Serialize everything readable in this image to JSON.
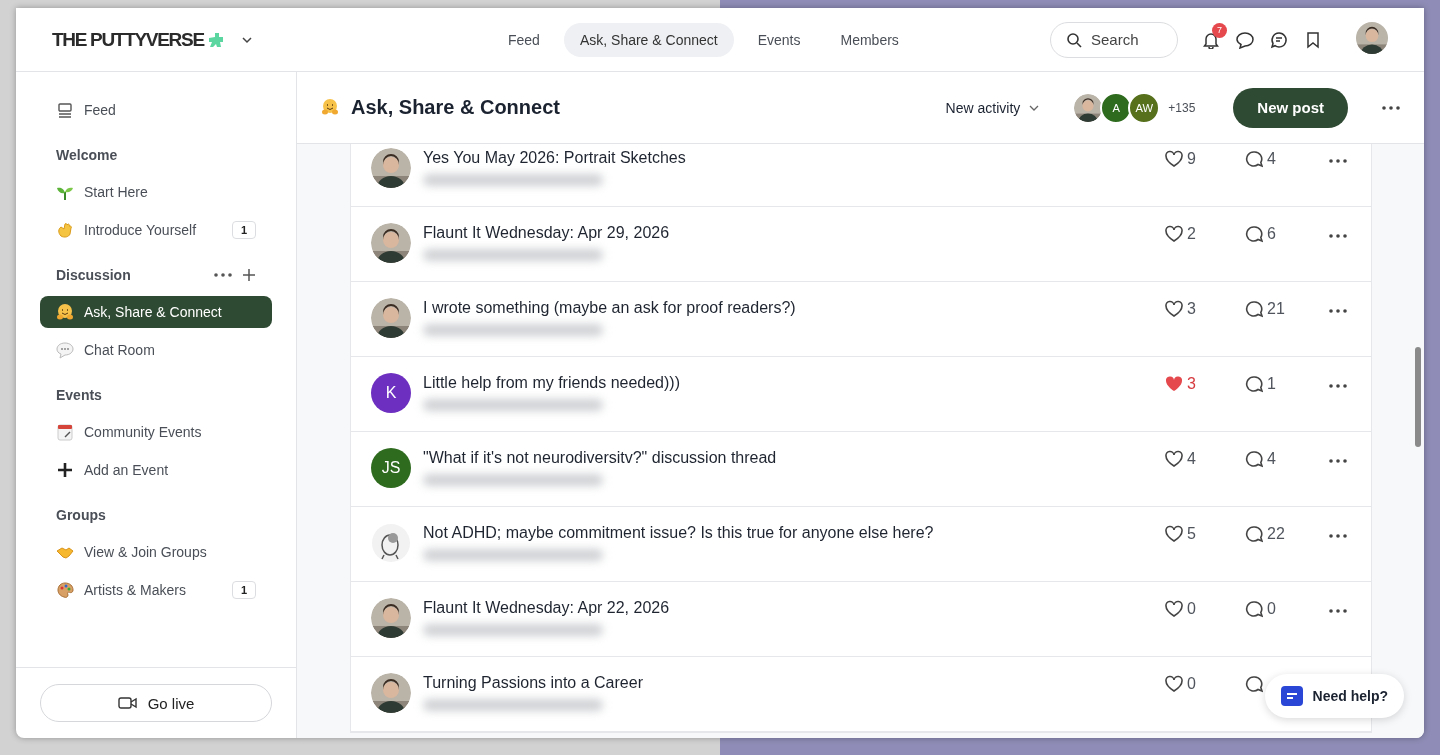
{
  "topbar": {
    "logo": "THE PUTTYVERSE",
    "tabs": [
      {
        "label": "Feed",
        "selected": false
      },
      {
        "label": "Ask, Share & Connect",
        "selected": true
      },
      {
        "label": "Events",
        "selected": false
      },
      {
        "label": "Members",
        "selected": false
      }
    ],
    "search": {
      "placeholder": "Search"
    },
    "notifications": "7"
  },
  "sidebar": {
    "feed": "Feed",
    "sections": [
      {
        "title": "Welcome",
        "actions": false,
        "items": [
          {
            "label": "Start Here",
            "selected": false
          },
          {
            "label": "Introduce Yourself",
            "selected": false,
            "count": "1"
          }
        ]
      },
      {
        "title": "Discussion",
        "actions": true,
        "items": [
          {
            "label": "Ask, Share & Connect",
            "selected": true
          },
          {
            "label": "Chat Room",
            "selected": false
          }
        ]
      },
      {
        "title": "Events",
        "actions": false,
        "items": [
          {
            "label": "Community Events",
            "selected": false
          },
          {
            "label": "Add an Event",
            "selected": false
          }
        ]
      },
      {
        "title": "Groups",
        "actions": false,
        "items": [
          {
            "label": "View & Join Groups",
            "selected": false
          },
          {
            "label": "Artists & Makers",
            "selected": false,
            "count": "1"
          }
        ]
      }
    ],
    "go_live": "Go live"
  },
  "header": {
    "title": "Ask, Share & Connect",
    "sort": "New activity",
    "members": [
      {
        "kind": "photo"
      },
      {
        "kind": "initials",
        "initials": "A",
        "color": "#2f6b1f"
      },
      {
        "kind": "initials",
        "initials": "AW",
        "color": "#56701c"
      }
    ],
    "member_count": "+135",
    "new_post": "New post"
  },
  "posts": [
    {
      "title": "Yes You May 2026: Portrait Sketches",
      "avatar": {
        "kind": "photo"
      },
      "likes": "9",
      "liked": false,
      "comments": "4"
    },
    {
      "title": "Flaunt It Wednesday: Apr 29, 2026",
      "avatar": {
        "kind": "photo"
      },
      "likes": "2",
      "liked": false,
      "comments": "6"
    },
    {
      "title": "I wrote something (maybe an ask for proof readers?)",
      "avatar": {
        "kind": "photo"
      },
      "likes": "3",
      "liked": false,
      "comments": "21"
    },
    {
      "title": "Little help from my friends needed)))",
      "avatar": {
        "kind": "initials",
        "initials": "K",
        "color": "#6d2fc0"
      },
      "likes": "3",
      "liked": true,
      "comments": "1"
    },
    {
      "title": "\"What if it's not neurodiversitv?\" discussion thread",
      "avatar": {
        "kind": "initials",
        "initials": "JS",
        "color": "#2f6b1f"
      },
      "likes": "4",
      "liked": false,
      "comments": "4"
    },
    {
      "title": "Not ADHD; maybe commitment issue? Is this true for anyone else here?",
      "avatar": {
        "kind": "drawing"
      },
      "likes": "5",
      "liked": false,
      "comments": "22"
    },
    {
      "title": "Flaunt It Wednesday: Apr 22, 2026",
      "avatar": {
        "kind": "photo"
      },
      "likes": "0",
      "liked": false,
      "comments": "0"
    },
    {
      "title": "Turning Passions into a Career",
      "avatar": {
        "kind": "photo"
      },
      "likes": "0",
      "liked": false
    }
  ],
  "help": "Need help?"
}
